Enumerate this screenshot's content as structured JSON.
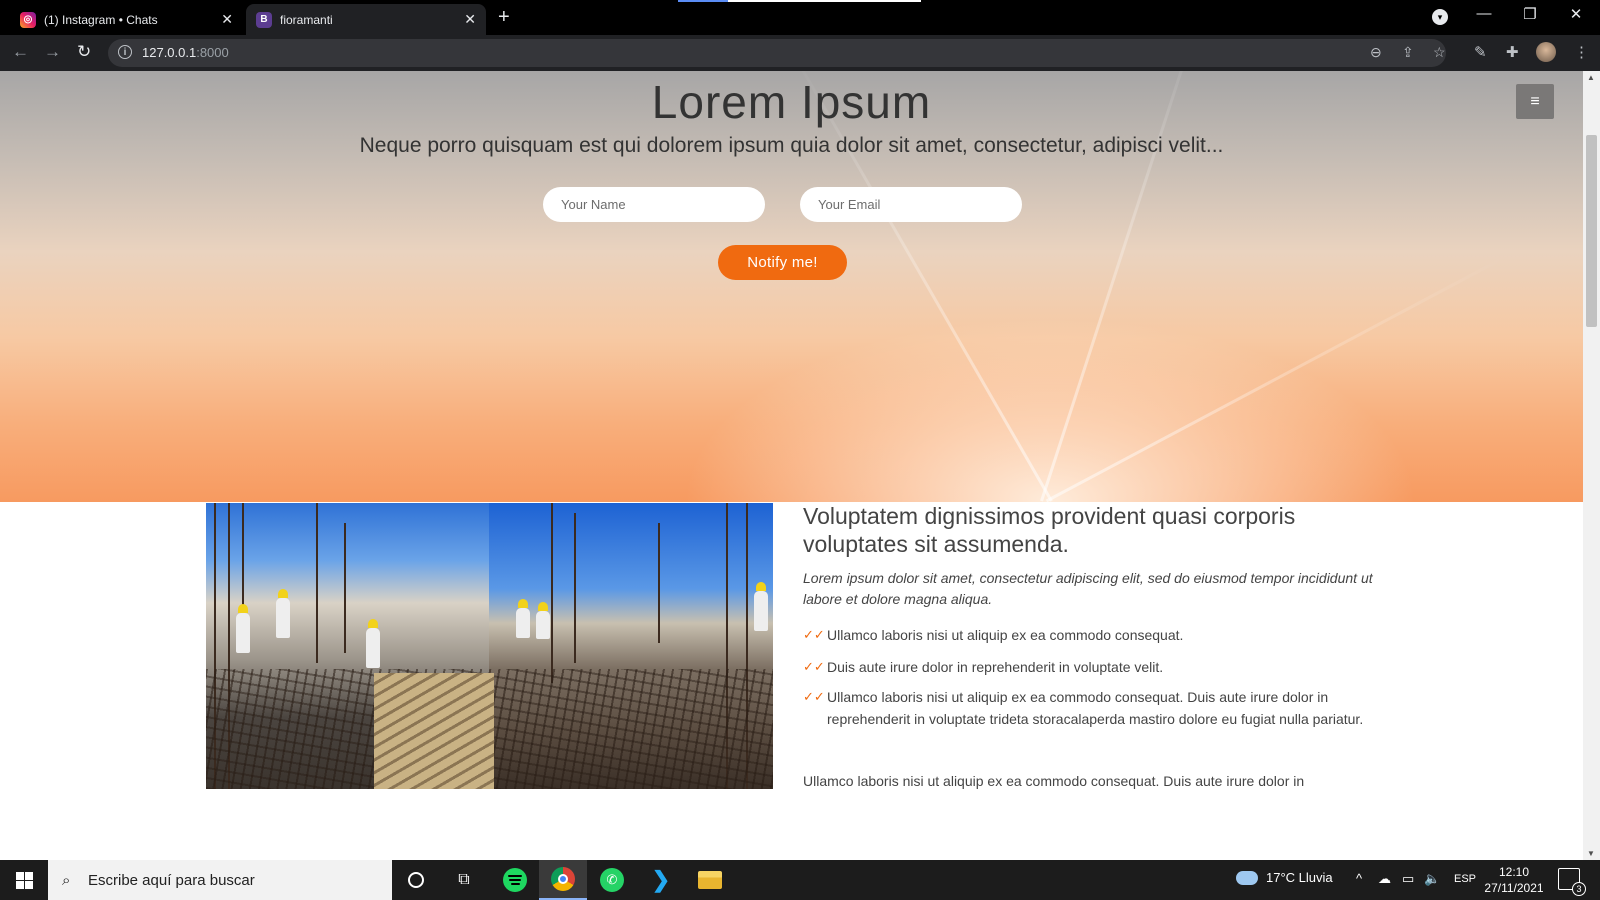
{
  "browser": {
    "tabs": [
      {
        "title": "(1) Instagram • Chats",
        "favicon": "instagram-icon"
      },
      {
        "title": "fioramanti",
        "favicon_letter": "B",
        "active": true
      }
    ],
    "new_tab_symbol": "+",
    "address": {
      "host": "127.0.0.1",
      "port": ":8000"
    },
    "icons": [
      "back-icon",
      "forward-icon",
      "reload-icon",
      "site-info-icon",
      "zoom-icon",
      "share-icon",
      "star-icon",
      "extensions-icon",
      "puzzle-icon",
      "profile-avatar",
      "menu-kebab-icon"
    ],
    "glyphs": {
      "back": "←",
      "forward": "→",
      "reload": "↻",
      "info": "i",
      "zoom": "⊖",
      "share": "⇪",
      "star": "☆",
      "pen": "✎",
      "puzzle": "✚",
      "kebab": "⋮",
      "minimize": "—",
      "maximize": "❐",
      "close": "✕",
      "tab_close": "✕",
      "tab_search": "▾"
    }
  },
  "hero": {
    "title": "Lorem Ipsum",
    "subtitle": "Neque porro quisquam est qui dolorem ipsum quia dolor sit amet, consectetur, adipisci velit...",
    "name_placeholder": "Your Name",
    "email_placeholder": "Your Email",
    "notify_label": "Notify me!",
    "menu_glyph": "≡",
    "accent_color": "#f06a10"
  },
  "about": {
    "title": "Voluptatem dignissimos provident quasi corporis voluptates sit assumenda.",
    "lead": "Lorem ipsum dolor sit amet, consectetur adipiscing elit, sed do eiusmod tempor incididunt ut labore et dolore magna aliqua.",
    "check_glyph": "✓✓",
    "features": [
      "Ullamco laboris nisi ut aliquip ex ea commodo consequat.",
      "Duis aute irure dolor in reprehenderit in voluptate velit.",
      "Ullamco laboris nisi ut aliquip ex ea commodo consequat. Duis aute irure dolor in reprehenderit in voluptate trideta storacalaperda mastiro dolore eu fugiat nulla pariatur."
    ],
    "more": "Ullamco laboris nisi ut aliquip ex ea commodo consequat. Duis aute irure dolor in"
  },
  "taskbar": {
    "search_placeholder": "Escribe aquí para buscar",
    "search_glyph": "⌕",
    "taskview_glyph": "⧉",
    "whatsapp_glyph": "✆",
    "vscode_glyph": "❯",
    "apps": [
      "cortana-icon",
      "task-view-icon",
      "spotify-icon",
      "chrome-icon",
      "whatsapp-icon",
      "vscode-icon",
      "file-explorer-icon"
    ],
    "weather": "17°C  Lluvia",
    "tray_glyphs": {
      "chevron": "^",
      "cloud": "☁",
      "network": "▭",
      "volume": "🔈"
    },
    "language": "ESP",
    "time": "12:10",
    "date": "27/11/2021",
    "notification_count": "3"
  }
}
